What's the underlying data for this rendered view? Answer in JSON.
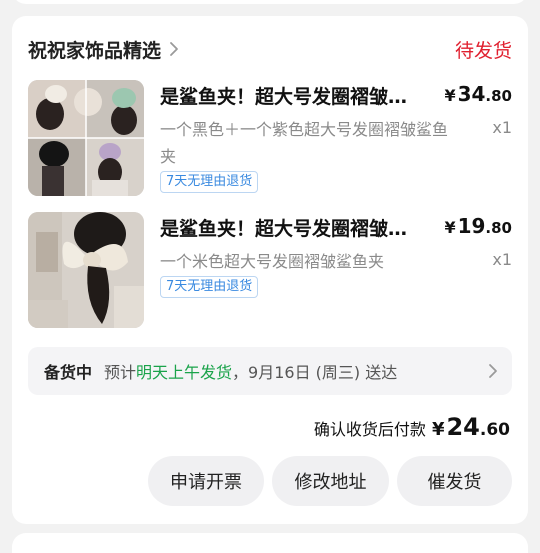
{
  "order": {
    "shop_name": "祝祝家饰品精选",
    "status": "待发货",
    "items": [
      {
        "title": "是鲨鱼夹！超大号发圈褶皱鲨鱼夹",
        "price_symbol": "¥",
        "price_int": "34",
        "price_dec": ".80",
        "spec": "一个黑色＋一个紫色超大号发圈褶皱鲨鱼夹",
        "qty": "x1",
        "tag": "7天无理由退货"
      },
      {
        "title": "是鲨鱼夹！超大号发圈褶皱鲨鱼夹",
        "price_symbol": "¥",
        "price_int": "19",
        "price_dec": ".80",
        "spec": "一个米色超大号发圈褶皱鲨鱼夹",
        "qty": "x1",
        "tag": "7天无理由退货"
      }
    ],
    "shipping": {
      "status": "备货中",
      "prefix": "预计",
      "highlight": "明天上午发货",
      "suffix": "，9月16日 (周三) 送达"
    },
    "payment": {
      "label": "确认收货后付款",
      "symbol": "¥",
      "int": "24",
      "dec": ".60"
    },
    "actions": [
      "申请开票",
      "修改地址",
      "催发货"
    ]
  },
  "icons": {
    "shop_chevron": "chevron-right-icon",
    "shipping_chevron": "chevron-right-icon"
  },
  "colors": {
    "status_red": "#e0202f",
    "ship_green": "#1aa34a",
    "tag_blue": "#3a8ae0"
  }
}
